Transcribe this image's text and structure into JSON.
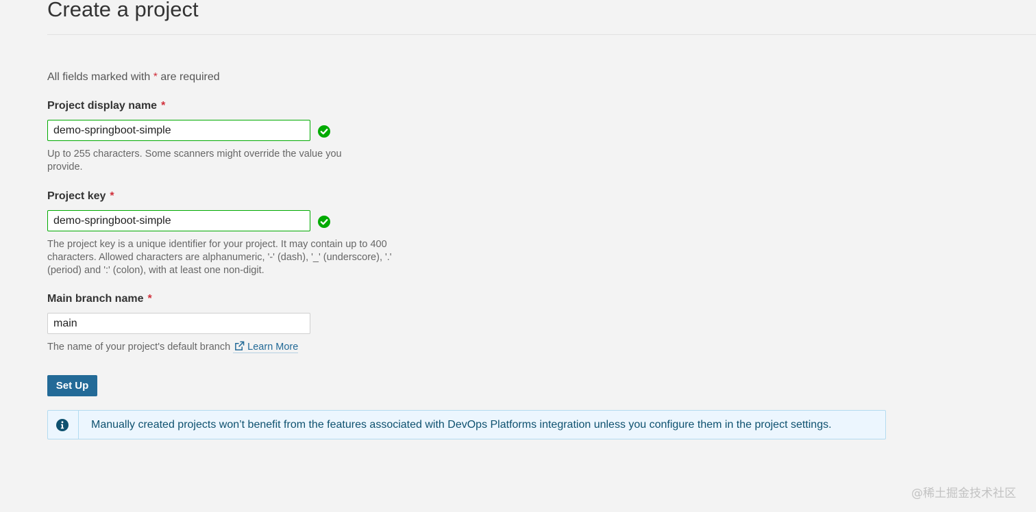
{
  "page": {
    "title": "Create a project",
    "required_note_prefix": "All fields marked with ",
    "required_star": "*",
    "required_note_suffix": " are required"
  },
  "fields": {
    "display_name": {
      "label": "Project display name",
      "value": "demo-springboot-simple",
      "help": "Up to 255 characters. Some scanners might override the value you provide.",
      "status": "valid"
    },
    "project_key": {
      "label": "Project key",
      "value": "demo-springboot-simple",
      "help": "The project key is a unique identifier for your project. It may contain up to 400 characters. Allowed characters are alphanumeric, '-' (dash), '_' (underscore), '.' (period) and ':' (colon), with at least one non-digit.",
      "status": "valid"
    },
    "main_branch": {
      "label": "Main branch name",
      "value": "main",
      "help": "The name of your project's default branch",
      "link_label": "Learn More",
      "link_icon": "external-link-icon"
    }
  },
  "actions": {
    "setup_label": "Set Up"
  },
  "info_box": {
    "icon": "info-icon",
    "text": "Manually created projects won’t benefit from the features associated with DevOps Platforms integration unless you configure them in the project settings."
  },
  "watermark": "@稀土掘金技术社区",
  "colors": {
    "background": "#f3f3f3",
    "primary_button": "#236a97",
    "valid_green": "#00aa00",
    "required_star": "#d02f3a",
    "info_background": "#ecf6fe",
    "info_border": "#b3dbf0",
    "info_text": "#0e516f",
    "link": "#236a97"
  }
}
